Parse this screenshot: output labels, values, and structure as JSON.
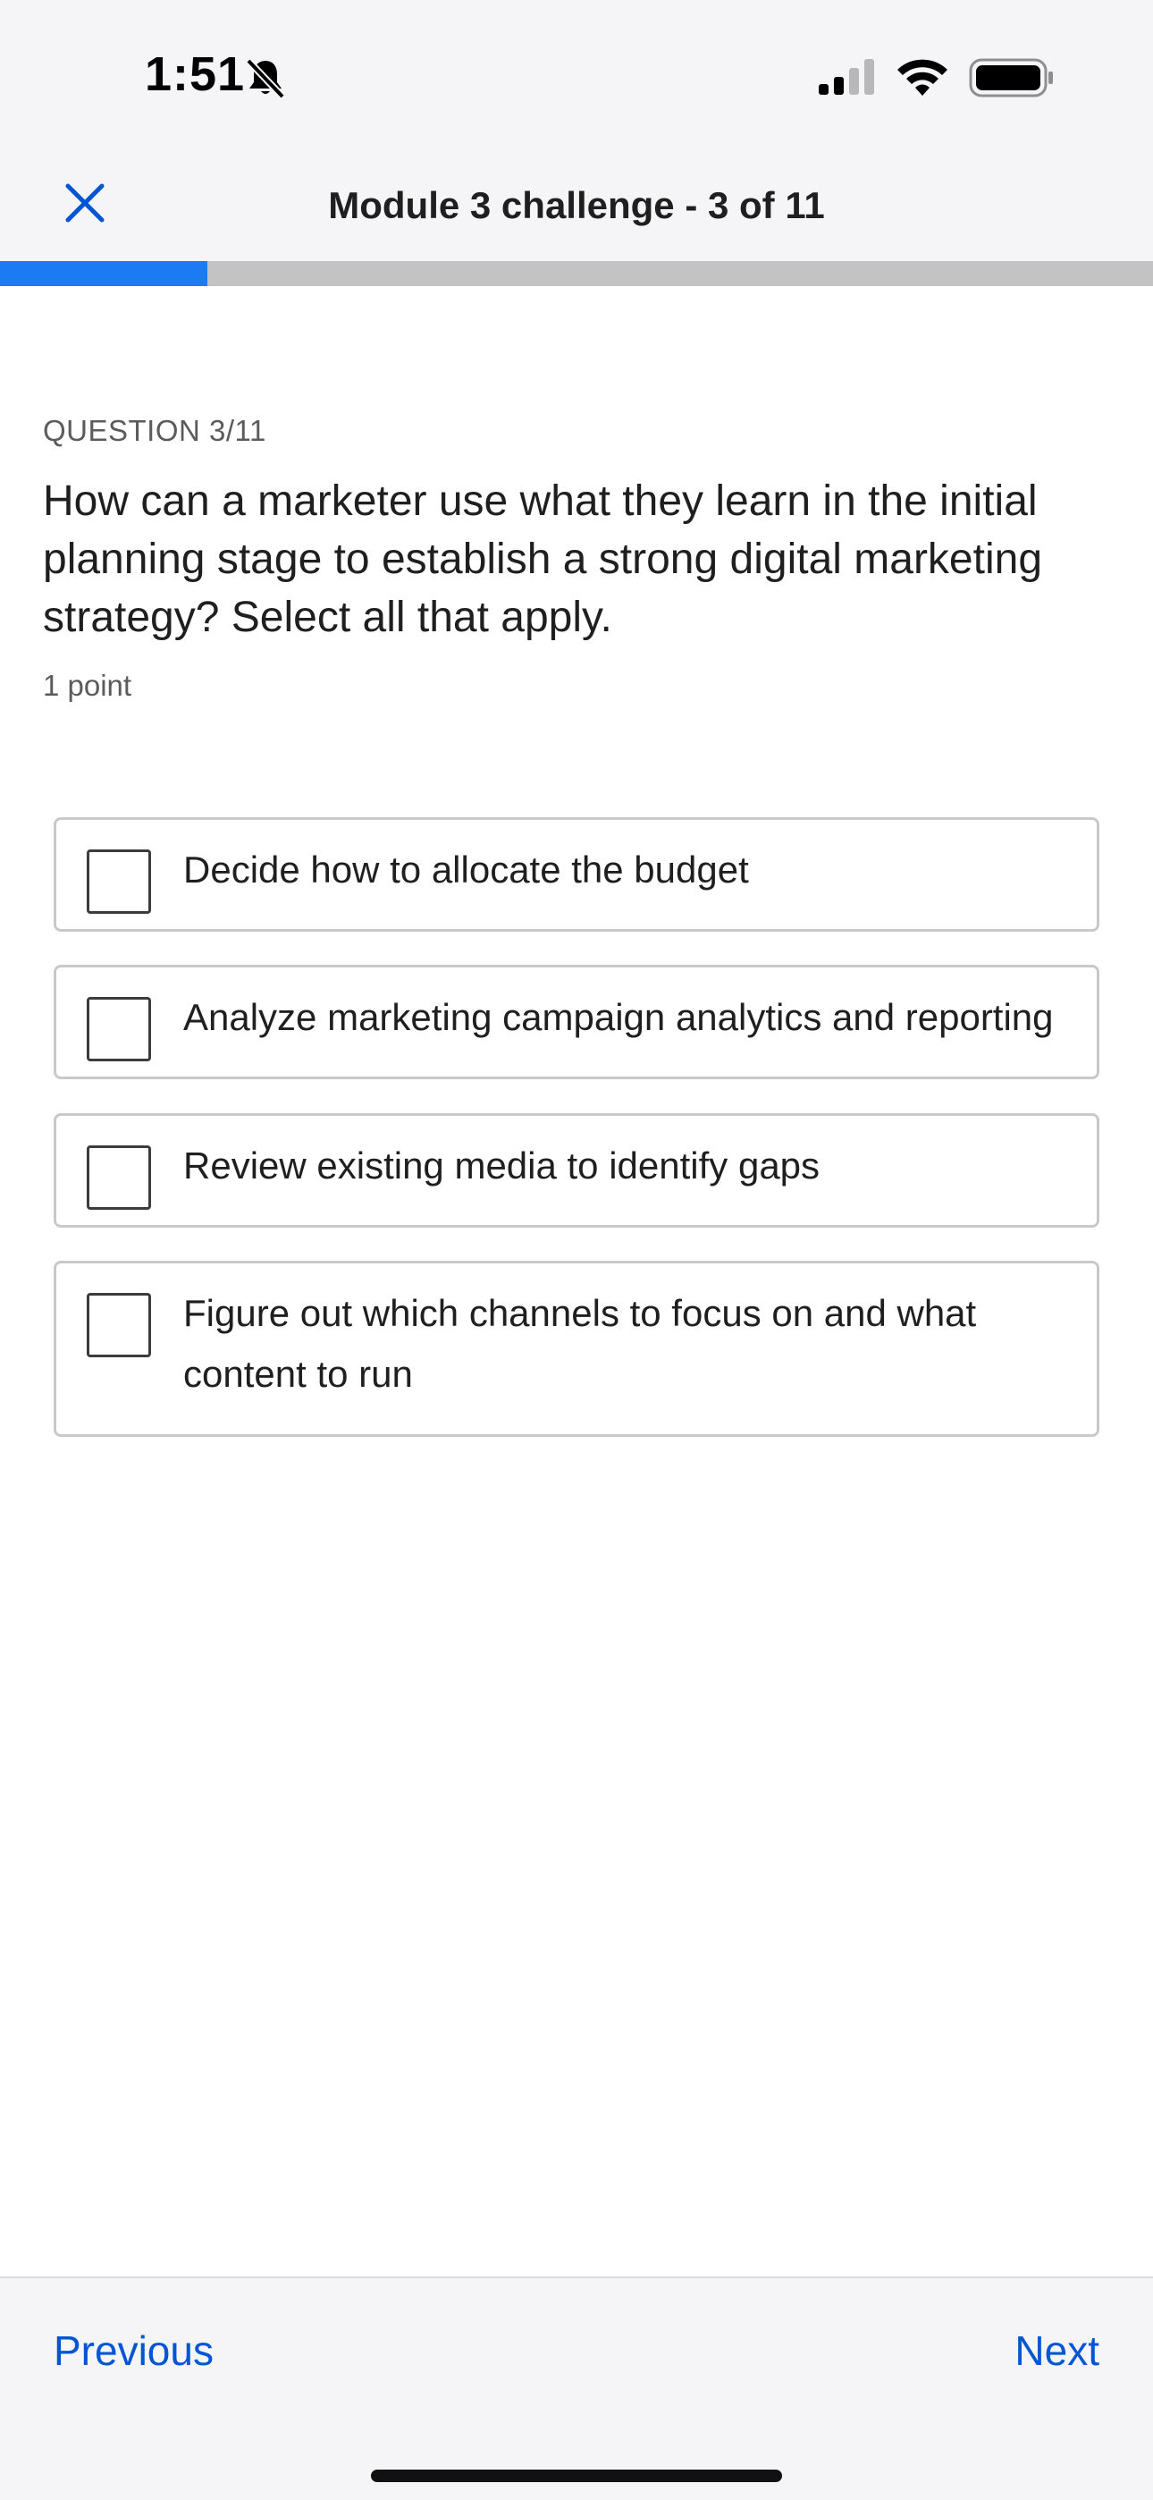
{
  "status_bar": {
    "time": "1:51",
    "icons": [
      "bell-off-icon",
      "signal-icon",
      "wifi-icon",
      "battery-icon"
    ]
  },
  "header": {
    "title": "Module 3 challenge - 3 of 11",
    "close_icon": "close-icon"
  },
  "progress": {
    "fraction": 0.18,
    "fill_color": "#1a7bf2",
    "track_color": "#c3c3c3"
  },
  "question": {
    "label": "QUESTION 3/11",
    "text": "How can a marketer use what they learn in the initial planning stage to establish a strong digital marketing strategy? Select all that apply.",
    "points": "1 point"
  },
  "options": [
    {
      "label": "Decide how to allocate the budget",
      "checked": false
    },
    {
      "label": "Analyze marketing campaign analytics and reporting",
      "checked": false
    },
    {
      "label": "Review existing media to identify gaps",
      "checked": false
    },
    {
      "label": "Figure out which channels to focus on and what content to run",
      "checked": false
    }
  ],
  "footer": {
    "previous_label": "Previous",
    "next_label": "Next",
    "link_color": "#0056d2"
  }
}
